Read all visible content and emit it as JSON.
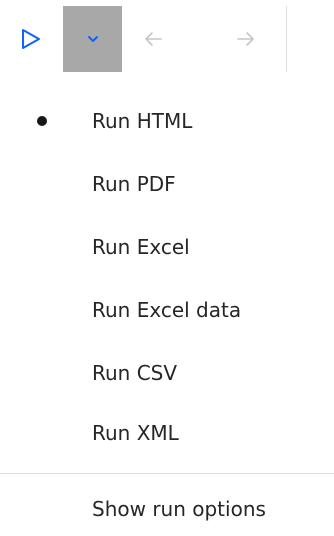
{
  "toolbar": {
    "run_icon": "play-outline-icon",
    "dropdown_icon": "chevron-down-icon",
    "back_icon": "arrow-left-icon",
    "forward_icon": "arrow-right-icon",
    "accent_color": "#0f62fe",
    "dropdown_active_bg": "#a8a8a8",
    "disabled_color": "#c6c6c6"
  },
  "menu": {
    "selected_indicator": "bullet-icon",
    "items": [
      {
        "label": "Run HTML",
        "selected": true
      },
      {
        "label": "Run PDF",
        "selected": false
      },
      {
        "label": "Run Excel",
        "selected": false
      },
      {
        "label": "Run Excel data",
        "selected": false
      },
      {
        "label": "Run CSV",
        "selected": false
      },
      {
        "label": "Run XML",
        "selected": false
      }
    ],
    "footer_item": {
      "label": "Show run options"
    }
  }
}
